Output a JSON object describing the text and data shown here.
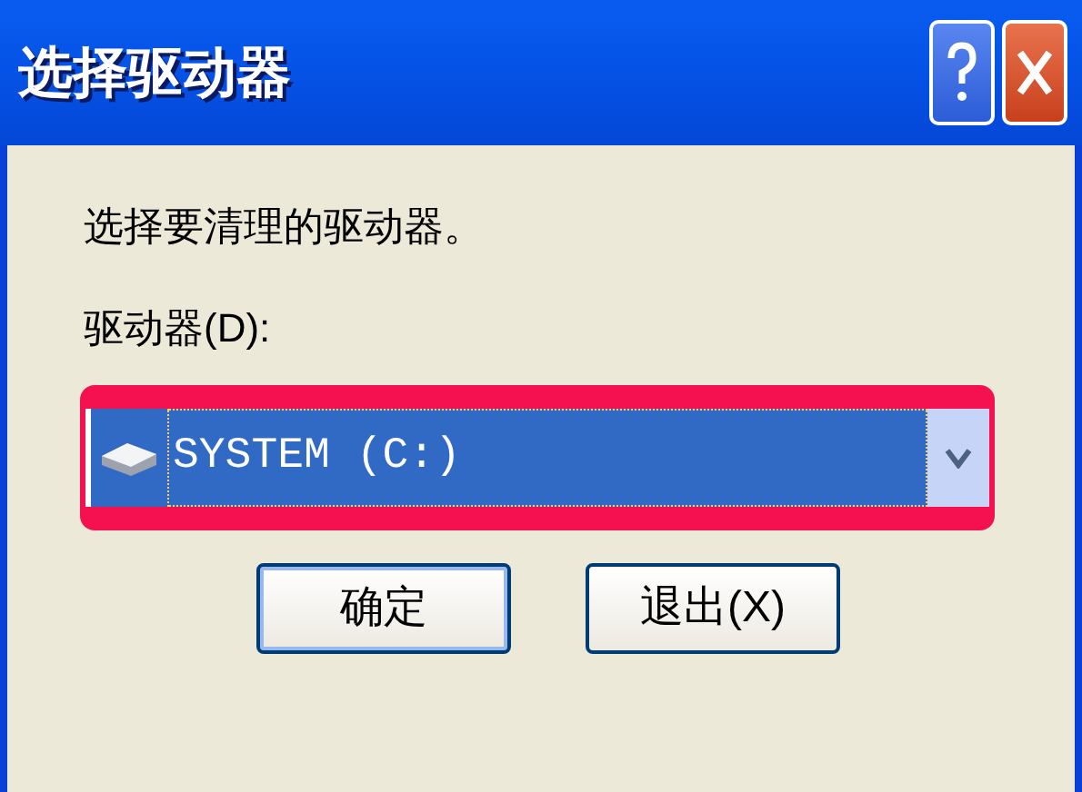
{
  "window": {
    "title": "选择驱动器"
  },
  "prompt": "选择要清理的驱动器。",
  "drive_label": "驱动器(D):",
  "drive_select": {
    "value": "SYSTEM (C:)",
    "highlighted": true
  },
  "buttons": [
    {
      "label": "确定",
      "default": true
    },
    {
      "label": "退出(X)",
      "default": false
    }
  ]
}
